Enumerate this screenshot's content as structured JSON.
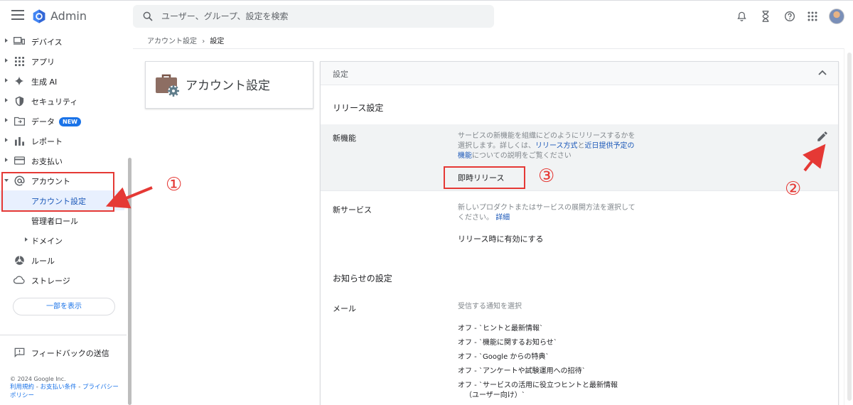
{
  "header": {
    "app_title": "Admin",
    "search_placeholder": "ユーザー、グループ、設定を検索",
    "icons": [
      "menu-icon",
      "google-admin-logo",
      "search-icon",
      "notifications-icon",
      "hourglass-icon",
      "help-icon",
      "apps-grid-icon",
      "avatar"
    ]
  },
  "sidebar": {
    "items": [
      {
        "label": "デバイス",
        "icon": "devices-icon"
      },
      {
        "label": "アプリ",
        "icon": "apps-grid-icon"
      },
      {
        "label": "生成 AI",
        "icon": "sparkle-icon"
      },
      {
        "label": "セキュリティ",
        "icon": "shield-icon"
      },
      {
        "label": "データ",
        "icon": "folder-icon",
        "badge": "NEW"
      },
      {
        "label": "レポート",
        "icon": "bar-chart-icon"
      },
      {
        "label": "お支払い",
        "icon": "credit-card-icon"
      },
      {
        "label": "アカウント",
        "icon": "at-icon"
      }
    ],
    "account_children": [
      {
        "label": "アカウント設定",
        "active": true
      },
      {
        "label": "管理者ロール"
      },
      {
        "label": "ドメイン"
      }
    ],
    "bottom_items": [
      {
        "label": "ルール",
        "icon": "rules-icon"
      },
      {
        "label": "ストレージ",
        "icon": "cloud-icon"
      }
    ],
    "show_less": "一部を表示",
    "feedback": "フィードバックの送信",
    "copyright": "© 2024 Google Inc.",
    "links": [
      "利用規約",
      "お支払い条件",
      "プライバシー ポリシー"
    ]
  },
  "breadcrumb": {
    "parent": "アカウント設定",
    "separator": "›",
    "current": "設定"
  },
  "account_card": {
    "title": "アカウント設定",
    "icon": "briefcase-gear-icon"
  },
  "settings_panel": {
    "header": "設定",
    "release_section": {
      "title": "リリース設定",
      "new_features": {
        "label": "新機能",
        "desc_pre": "サービスの新機能を組織にどのようにリリースするかを選択します。詳しくは、",
        "link1": "リリース方式",
        "desc_mid": "と",
        "link2": "近日提供予定の機能",
        "desc_post": "についての説明をご覧ください",
        "value": "即時リリース"
      },
      "new_services": {
        "label": "新サービス",
        "desc": "新しいプロダクトまたはサービスの展開方法を選択してください。",
        "link": "詳細",
        "value": "リリース時に有効にする"
      }
    },
    "notification_section": {
      "title": "お知らせの設定",
      "mail": {
        "label": "メール",
        "desc": "受信する通知を選択",
        "items": [
          "オフ - `ヒントと最新情報`",
          "オフ - `機能に関するお知らせ`",
          "オフ - `Google からの特典`",
          "オフ - `アンケートや試験運用への招待`",
          "オフ - `サービスの活用に役立つヒントと最新情報",
          "（ユーザー向け）`"
        ]
      }
    }
  },
  "annotations": {
    "markers": [
      "①",
      "②",
      "③"
    ],
    "color": "#e53935"
  }
}
